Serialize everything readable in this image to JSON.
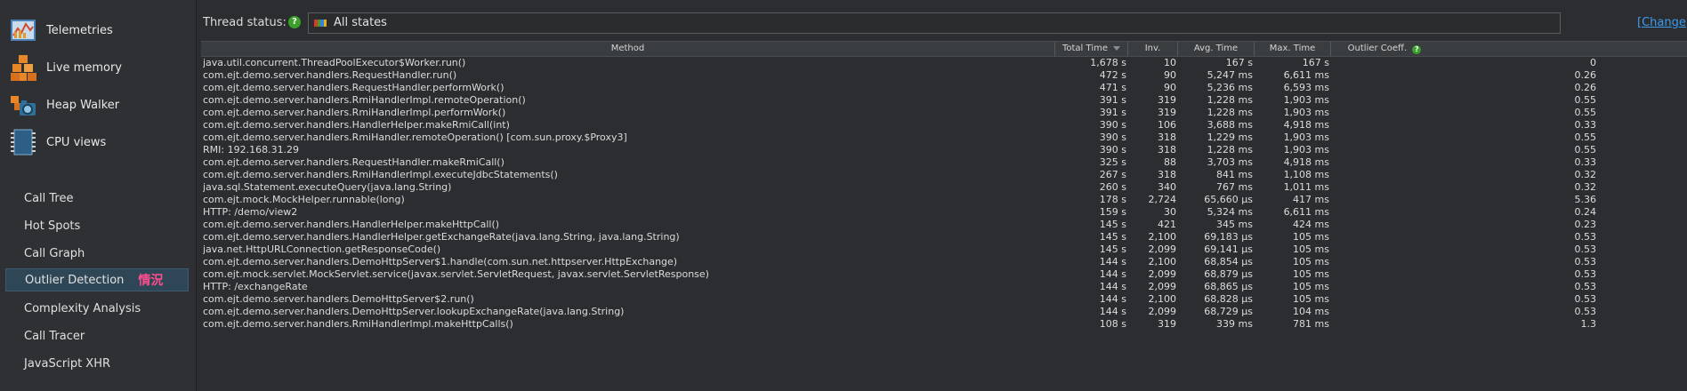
{
  "sidebar": {
    "sections": [
      {
        "label": "Telemetries",
        "icon": "telemetries-icon"
      },
      {
        "label": "Live memory",
        "icon": "live-memory-icon"
      },
      {
        "label": "Heap Walker",
        "icon": "heap-walker-icon"
      },
      {
        "label": "CPU views",
        "icon": "cpu-views-icon"
      }
    ],
    "cpu_items": [
      {
        "label": "Call Tree"
      },
      {
        "label": "Hot Spots"
      },
      {
        "label": "Call Graph"
      },
      {
        "label": "Outlier Detection",
        "annotation": "情況"
      },
      {
        "label": "Complexity Analysis"
      },
      {
        "label": "Call Tracer"
      },
      {
        "label": "JavaScript XHR"
      }
    ],
    "selected": "Outlier Detection"
  },
  "toolbar": {
    "thread_status_label": "Thread status:",
    "help_glyph": "?",
    "state_value": "All states",
    "change_link": "[Change]"
  },
  "table": {
    "columns": [
      "Method",
      "Total Time",
      "Inv.",
      "Avg. Time",
      "Max. Time",
      "Outlier Coeff."
    ],
    "sorted_by": "Total Time",
    "rows": [
      [
        "java.util.concurrent.ThreadPoolExecutor$Worker.run()",
        "1,678 s",
        "10",
        "167 s",
        "167 s",
        "0"
      ],
      [
        "com.ejt.demo.server.handlers.RequestHandler.run()",
        "472 s",
        "90",
        "5,247 ms",
        "6,611 ms",
        "0.26"
      ],
      [
        "com.ejt.demo.server.handlers.RequestHandler.performWork()",
        "471 s",
        "90",
        "5,236 ms",
        "6,593 ms",
        "0.26"
      ],
      [
        "com.ejt.demo.server.handlers.RmiHandlerImpl.remoteOperation()",
        "391 s",
        "319",
        "1,228 ms",
        "1,903 ms",
        "0.55"
      ],
      [
        "com.ejt.demo.server.handlers.RmiHandlerImpl.performWork()",
        "391 s",
        "319",
        "1,228 ms",
        "1,903 ms",
        "0.55"
      ],
      [
        "com.ejt.demo.server.handlers.HandlerHelper.makeRmiCall(int)",
        "390 s",
        "106",
        "3,688 ms",
        "4,918 ms",
        "0.33"
      ],
      [
        "com.ejt.demo.server.handlers.RmiHandler.remoteOperation() [com.sun.proxy.$Proxy3]",
        "390 s",
        "318",
        "1,229 ms",
        "1,903 ms",
        "0.55"
      ],
      [
        "RMI: 192.168.31.29",
        "390 s",
        "318",
        "1,228 ms",
        "1,903 ms",
        "0.55"
      ],
      [
        "com.ejt.demo.server.handlers.RequestHandler.makeRmiCall()",
        "325 s",
        "88",
        "3,703 ms",
        "4,918 ms",
        "0.33"
      ],
      [
        "com.ejt.demo.server.handlers.RmiHandlerImpl.executeJdbcStatements()",
        "267 s",
        "318",
        "841 ms",
        "1,108 ms",
        "0.32"
      ],
      [
        "java.sql.Statement.executeQuery(java.lang.String)",
        "260 s",
        "340",
        "767 ms",
        "1,011 ms",
        "0.32"
      ],
      [
        "com.ejt.mock.MockHelper.runnable(long)",
        "178 s",
        "2,724",
        "65,660 µs",
        "417 ms",
        "5.36"
      ],
      [
        "HTTP: /demo/view2",
        "159 s",
        "30",
        "5,324 ms",
        "6,611 ms",
        "0.24"
      ],
      [
        "com.ejt.demo.server.handlers.HandlerHelper.makeHttpCall()",
        "145 s",
        "421",
        "345 ms",
        "424 ms",
        "0.23"
      ],
      [
        "com.ejt.demo.server.handlers.HandlerHelper.getExchangeRate(java.lang.String, java.lang.String)",
        "145 s",
        "2,100",
        "69,183 µs",
        "105 ms",
        "0.53"
      ],
      [
        "java.net.HttpURLConnection.getResponseCode()",
        "145 s",
        "2,099",
        "69,141 µs",
        "105 ms",
        "0.53"
      ],
      [
        "com.ejt.demo.server.handlers.DemoHttpServer$1.handle(com.sun.net.httpserver.HttpExchange)",
        "144 s",
        "2,100",
        "68,854 µs",
        "105 ms",
        "0.53"
      ],
      [
        "com.ejt.mock.servlet.MockServlet.service(javax.servlet.ServletRequest, javax.servlet.ServletResponse)",
        "144 s",
        "2,099",
        "68,879 µs",
        "105 ms",
        "0.53"
      ],
      [
        "HTTP: /exchangeRate",
        "144 s",
        "2,099",
        "68,865 µs",
        "105 ms",
        "0.53"
      ],
      [
        "com.ejt.demo.server.handlers.DemoHttpServer$2.run()",
        "144 s",
        "2,100",
        "68,828 µs",
        "105 ms",
        "0.53"
      ],
      [
        "com.ejt.demo.server.handlers.DemoHttpServer.lookupExchangeRate(java.lang.String)",
        "144 s",
        "2,099",
        "68,729 µs",
        "104 ms",
        "0.53"
      ],
      [
        "com.ejt.demo.server.handlers.RmiHandlerImpl.makeHttpCalls()",
        "108 s",
        "319",
        "339 ms",
        "781 ms",
        "1.3"
      ]
    ]
  },
  "colors": {
    "accent_link": "#3d9cf0",
    "selection": "#2f4656",
    "help_green": "#3aa02a",
    "annotation_pink": "#ff4d8d"
  }
}
